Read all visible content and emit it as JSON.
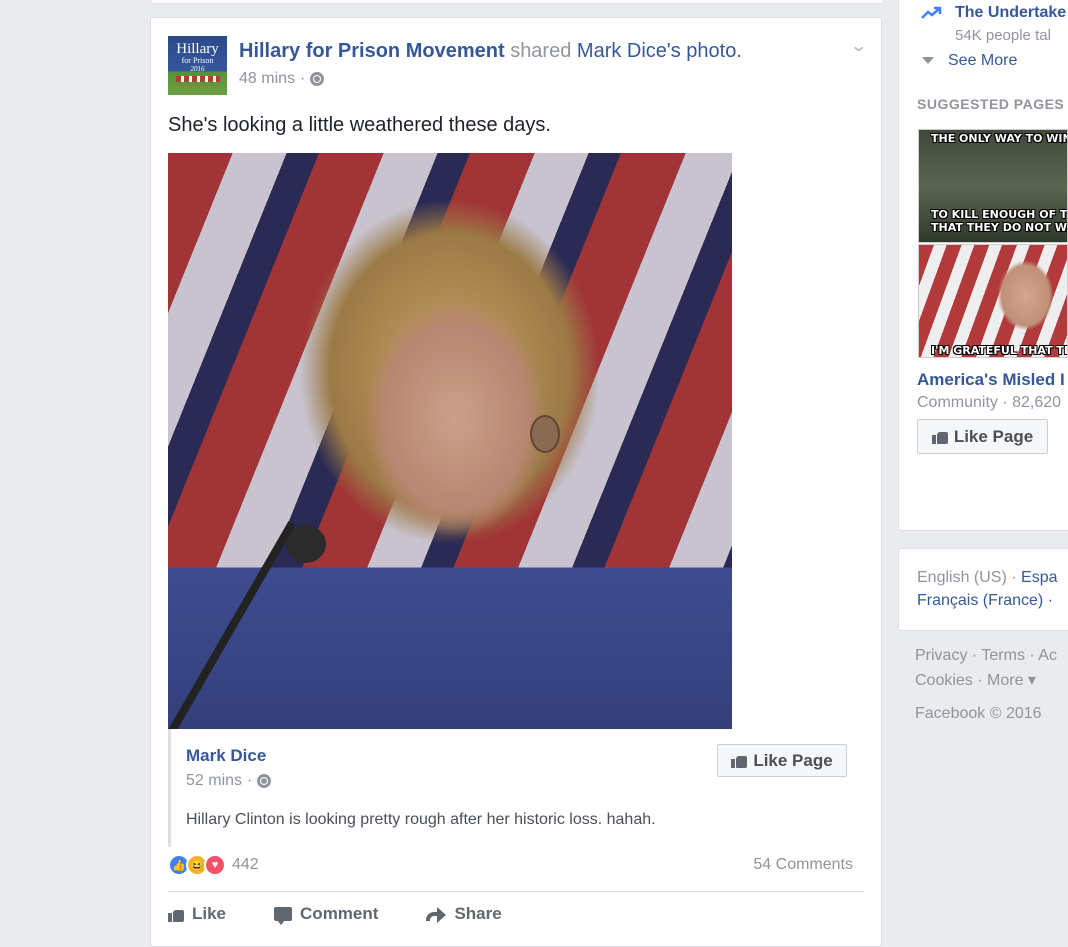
{
  "post": {
    "page_name": "Hillary for Prison Movement",
    "shared_word": "shared",
    "shared_owner": "Mark Dice",
    "shared_suffix": "'s photo.",
    "time": "48 mins",
    "separator": "·",
    "text": "She's looking a little weathered these days.",
    "avatar": {
      "line1": "Hillary",
      "line2": "for Prison",
      "line3": "2016"
    }
  },
  "shared_attribution": {
    "name": "Mark Dice",
    "time": "52 mins",
    "caption": "Hillary Clinton is looking pretty rough after her historic loss. hahah.",
    "like_page_label": "Like Page"
  },
  "engagement": {
    "reaction_count": "442",
    "comments": "54 Comments",
    "reactions": [
      "like",
      "haha",
      "love"
    ]
  },
  "actions": {
    "like": "Like",
    "comment": "Comment",
    "share": "Share"
  },
  "sidebar": {
    "trending_title": "The Undertake",
    "trending_sub": "54K people tal",
    "see_more": "See More",
    "suggested_title": "SUGGESTED PAGES",
    "meme1_top": "THE ONLY WAY TO WIN A",
    "meme1_bottom1": "TO KILL ENOUGH OF THE",
    "meme1_bottom2": "THAT THEY DO NOT WANT T",
    "meme2_bottom": "I'M GRATEFUL THAT TH",
    "page_name": "America's Misled I",
    "page_category": "Community · 82,620",
    "like_page": "Like Page",
    "lang_english": "English (US)",
    "lang_sep": " · ",
    "lang_espanol": "Espa",
    "lang_francais": "Français (France) ·",
    "footer_line1": "Privacy · Terms · Ac",
    "footer_line2": "Cookies · More ▾",
    "copyright": "Facebook © 2016"
  },
  "colors": {
    "link": "#365899",
    "muted": "#90949c",
    "background": "#e9ebee",
    "like_blue": "#4080ff",
    "love_red": "#f25268",
    "haha_yellow": "#f7b125"
  }
}
